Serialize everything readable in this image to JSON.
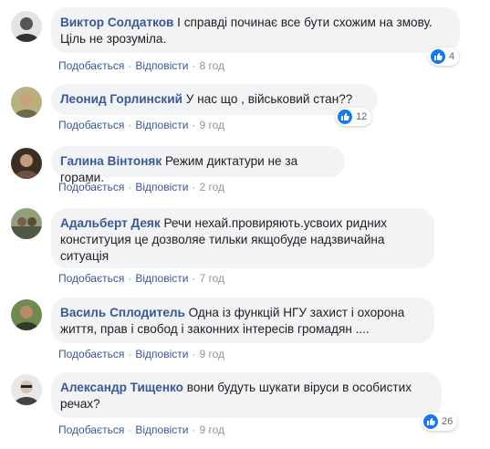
{
  "comments": [
    {
      "author": "Виктор Солдатков",
      "text": "І справді починає все бути схожим на змову. Ціль не зрозуміла.",
      "like_label": "Подобається",
      "reply_label": "Відповісти",
      "time": "8 год",
      "reaction_count": "4",
      "reaction_icon": "like-icon",
      "avatar_color": "#6b6b6b"
    },
    {
      "author": "Леонид Горлинский",
      "text": "У нас що , військовий стан??",
      "like_label": "Подобається",
      "reply_label": "Відповісти",
      "time": "9 год",
      "reaction_count": "12",
      "reaction_icon": "like-icon",
      "avatar_color": "#8a7a55"
    },
    {
      "author": "Галина Вінтоняк",
      "text": "Режим диктатури не за горами.",
      "like_label": "Подобається",
      "reply_label": "Відповісти",
      "time": "2 год",
      "avatar_color": "#5b4634"
    },
    {
      "author": "Адальберт Деяк",
      "text": "Речи нехай.провиряють.усвоих ридних конституция це дозволяе тильки якщобуде надзвичайна ситуація",
      "like_label": "Подобається",
      "reply_label": "Відповісти",
      "time": "7 год",
      "avatar_color": "#4f5a45"
    },
    {
      "author": "Василь Сплодитель",
      "text": "Одна із функцій НГУ захист і охорона життя, прав і свобод і законних інтересів громадян ....",
      "like_label": "Подобається",
      "reply_label": "Відповісти",
      "time": "9 год",
      "avatar_color": "#4a5f3a"
    },
    {
      "author": "Александр Тищенко",
      "text": "вони будуть шукати віруси в особистих речах?",
      "like_label": "Подобається",
      "reply_label": "Відповісти",
      "time": "9 год",
      "reaction_count": "26",
      "reaction_icon": "like-icon",
      "avatar_color": "#c9c9c9"
    }
  ],
  "colors": {
    "author_link": "#385898",
    "bubble_bg": "#f2f3f5",
    "meta_text": "#90949c",
    "like_blue": "#1877f2"
  }
}
